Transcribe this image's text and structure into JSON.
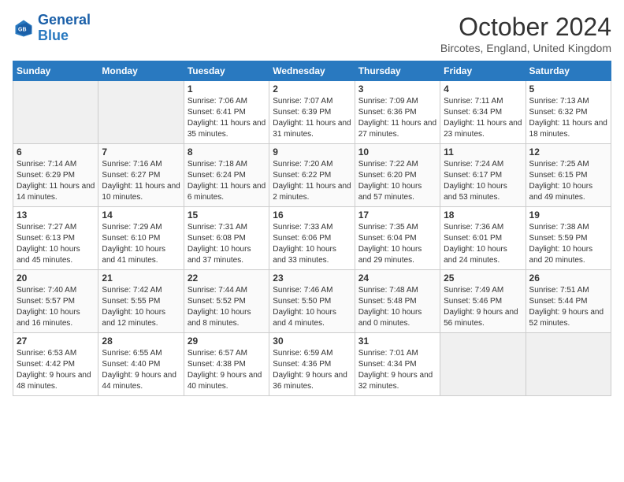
{
  "header": {
    "logo_general": "General",
    "logo_blue": "Blue",
    "month": "October 2024",
    "location": "Bircotes, England, United Kingdom"
  },
  "days_of_week": [
    "Sunday",
    "Monday",
    "Tuesday",
    "Wednesday",
    "Thursday",
    "Friday",
    "Saturday"
  ],
  "weeks": [
    [
      {
        "day": "",
        "empty": true
      },
      {
        "day": "",
        "empty": true
      },
      {
        "day": "1",
        "sunrise": "Sunrise: 7:06 AM",
        "sunset": "Sunset: 6:41 PM",
        "daylight": "Daylight: 11 hours and 35 minutes."
      },
      {
        "day": "2",
        "sunrise": "Sunrise: 7:07 AM",
        "sunset": "Sunset: 6:39 PM",
        "daylight": "Daylight: 11 hours and 31 minutes."
      },
      {
        "day": "3",
        "sunrise": "Sunrise: 7:09 AM",
        "sunset": "Sunset: 6:36 PM",
        "daylight": "Daylight: 11 hours and 27 minutes."
      },
      {
        "day": "4",
        "sunrise": "Sunrise: 7:11 AM",
        "sunset": "Sunset: 6:34 PM",
        "daylight": "Daylight: 11 hours and 23 minutes."
      },
      {
        "day": "5",
        "sunrise": "Sunrise: 7:13 AM",
        "sunset": "Sunset: 6:32 PM",
        "daylight": "Daylight: 11 hours and 18 minutes."
      }
    ],
    [
      {
        "day": "6",
        "sunrise": "Sunrise: 7:14 AM",
        "sunset": "Sunset: 6:29 PM",
        "daylight": "Daylight: 11 hours and 14 minutes."
      },
      {
        "day": "7",
        "sunrise": "Sunrise: 7:16 AM",
        "sunset": "Sunset: 6:27 PM",
        "daylight": "Daylight: 11 hours and 10 minutes."
      },
      {
        "day": "8",
        "sunrise": "Sunrise: 7:18 AM",
        "sunset": "Sunset: 6:24 PM",
        "daylight": "Daylight: 11 hours and 6 minutes."
      },
      {
        "day": "9",
        "sunrise": "Sunrise: 7:20 AM",
        "sunset": "Sunset: 6:22 PM",
        "daylight": "Daylight: 11 hours and 2 minutes."
      },
      {
        "day": "10",
        "sunrise": "Sunrise: 7:22 AM",
        "sunset": "Sunset: 6:20 PM",
        "daylight": "Daylight: 10 hours and 57 minutes."
      },
      {
        "day": "11",
        "sunrise": "Sunrise: 7:24 AM",
        "sunset": "Sunset: 6:17 PM",
        "daylight": "Daylight: 10 hours and 53 minutes."
      },
      {
        "day": "12",
        "sunrise": "Sunrise: 7:25 AM",
        "sunset": "Sunset: 6:15 PM",
        "daylight": "Daylight: 10 hours and 49 minutes."
      }
    ],
    [
      {
        "day": "13",
        "sunrise": "Sunrise: 7:27 AM",
        "sunset": "Sunset: 6:13 PM",
        "daylight": "Daylight: 10 hours and 45 minutes."
      },
      {
        "day": "14",
        "sunrise": "Sunrise: 7:29 AM",
        "sunset": "Sunset: 6:10 PM",
        "daylight": "Daylight: 10 hours and 41 minutes."
      },
      {
        "day": "15",
        "sunrise": "Sunrise: 7:31 AM",
        "sunset": "Sunset: 6:08 PM",
        "daylight": "Daylight: 10 hours and 37 minutes."
      },
      {
        "day": "16",
        "sunrise": "Sunrise: 7:33 AM",
        "sunset": "Sunset: 6:06 PM",
        "daylight": "Daylight: 10 hours and 33 minutes."
      },
      {
        "day": "17",
        "sunrise": "Sunrise: 7:35 AM",
        "sunset": "Sunset: 6:04 PM",
        "daylight": "Daylight: 10 hours and 29 minutes."
      },
      {
        "day": "18",
        "sunrise": "Sunrise: 7:36 AM",
        "sunset": "Sunset: 6:01 PM",
        "daylight": "Daylight: 10 hours and 24 minutes."
      },
      {
        "day": "19",
        "sunrise": "Sunrise: 7:38 AM",
        "sunset": "Sunset: 5:59 PM",
        "daylight": "Daylight: 10 hours and 20 minutes."
      }
    ],
    [
      {
        "day": "20",
        "sunrise": "Sunrise: 7:40 AM",
        "sunset": "Sunset: 5:57 PM",
        "daylight": "Daylight: 10 hours and 16 minutes."
      },
      {
        "day": "21",
        "sunrise": "Sunrise: 7:42 AM",
        "sunset": "Sunset: 5:55 PM",
        "daylight": "Daylight: 10 hours and 12 minutes."
      },
      {
        "day": "22",
        "sunrise": "Sunrise: 7:44 AM",
        "sunset": "Sunset: 5:52 PM",
        "daylight": "Daylight: 10 hours and 8 minutes."
      },
      {
        "day": "23",
        "sunrise": "Sunrise: 7:46 AM",
        "sunset": "Sunset: 5:50 PM",
        "daylight": "Daylight: 10 hours and 4 minutes."
      },
      {
        "day": "24",
        "sunrise": "Sunrise: 7:48 AM",
        "sunset": "Sunset: 5:48 PM",
        "daylight": "Daylight: 10 hours and 0 minutes."
      },
      {
        "day": "25",
        "sunrise": "Sunrise: 7:49 AM",
        "sunset": "Sunset: 5:46 PM",
        "daylight": "Daylight: 9 hours and 56 minutes."
      },
      {
        "day": "26",
        "sunrise": "Sunrise: 7:51 AM",
        "sunset": "Sunset: 5:44 PM",
        "daylight": "Daylight: 9 hours and 52 minutes."
      }
    ],
    [
      {
        "day": "27",
        "sunrise": "Sunrise: 6:53 AM",
        "sunset": "Sunset: 4:42 PM",
        "daylight": "Daylight: 9 hours and 48 minutes."
      },
      {
        "day": "28",
        "sunrise": "Sunrise: 6:55 AM",
        "sunset": "Sunset: 4:40 PM",
        "daylight": "Daylight: 9 hours and 44 minutes."
      },
      {
        "day": "29",
        "sunrise": "Sunrise: 6:57 AM",
        "sunset": "Sunset: 4:38 PM",
        "daylight": "Daylight: 9 hours and 40 minutes."
      },
      {
        "day": "30",
        "sunrise": "Sunrise: 6:59 AM",
        "sunset": "Sunset: 4:36 PM",
        "daylight": "Daylight: 9 hours and 36 minutes."
      },
      {
        "day": "31",
        "sunrise": "Sunrise: 7:01 AM",
        "sunset": "Sunset: 4:34 PM",
        "daylight": "Daylight: 9 hours and 32 minutes."
      },
      {
        "day": "",
        "empty": true
      },
      {
        "day": "",
        "empty": true
      }
    ]
  ]
}
